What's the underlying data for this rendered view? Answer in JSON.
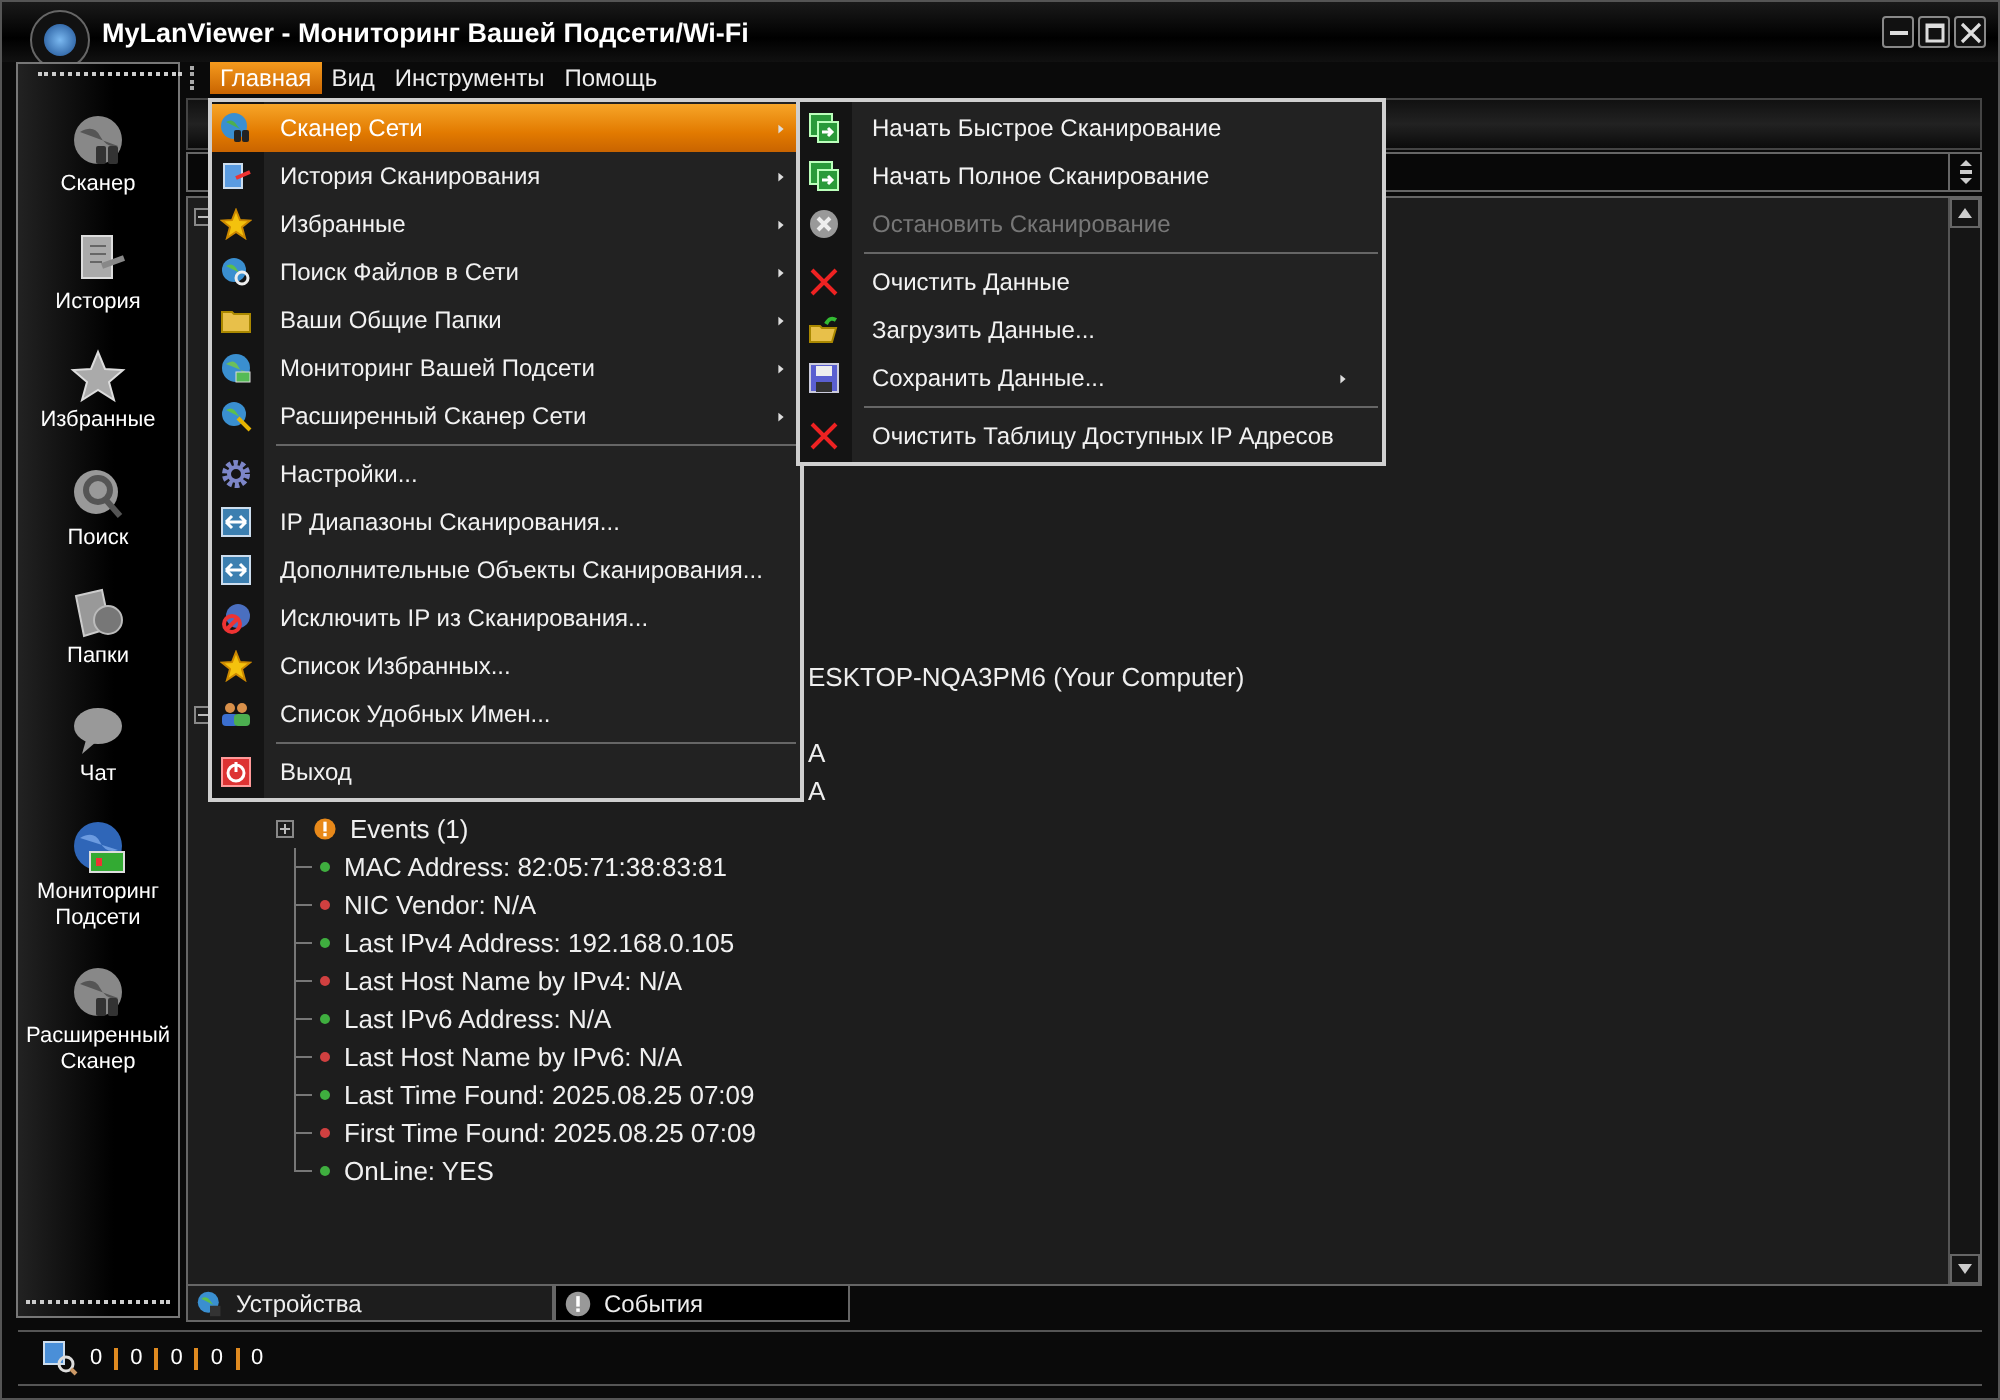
{
  "window": {
    "title": "MyLanViewer - Мониторинг Вашей Подсети/Wi-Fi"
  },
  "sidebar": {
    "items": [
      {
        "label": "Сканер"
      },
      {
        "label": "История"
      },
      {
        "label": "Избранные"
      },
      {
        "label": "Поиск"
      },
      {
        "label": "Папки"
      },
      {
        "label": "Чат"
      },
      {
        "label": "Мониторинг Подсети"
      },
      {
        "label": "Расширенный Сканер"
      }
    ]
  },
  "menu_bar": [
    {
      "label": "Главная",
      "selected": true
    },
    {
      "label": "Вид",
      "selected": false
    },
    {
      "label": "Инструменты",
      "selected": false
    },
    {
      "label": "Помощь",
      "selected": false
    }
  ],
  "main_menu": [
    {
      "kind": "item",
      "label": "Сканер Сети",
      "submenu": true,
      "selected": true
    },
    {
      "kind": "item",
      "label": "История Сканирования",
      "submenu": true,
      "selected": false
    },
    {
      "kind": "item",
      "label": "Избранные",
      "submenu": true,
      "selected": false
    },
    {
      "kind": "item",
      "label": "Поиск Файлов в Сети",
      "submenu": true,
      "selected": false
    },
    {
      "kind": "item",
      "label": "Ваши Общие Папки",
      "submenu": true,
      "selected": false
    },
    {
      "kind": "item",
      "label": "Мониторинг Вашей Подсети",
      "submenu": true,
      "selected": false
    },
    {
      "kind": "item",
      "label": "Расширенный Сканер Сети",
      "submenu": true,
      "selected": false
    },
    {
      "kind": "separator"
    },
    {
      "kind": "item",
      "label": "Настройки...",
      "submenu": false,
      "selected": false
    },
    {
      "kind": "item",
      "label": "IP Диапазоны Сканирования...",
      "submenu": false,
      "selected": false
    },
    {
      "kind": "item",
      "label": "Дополнительные Объекты Сканирования...",
      "submenu": false,
      "selected": false
    },
    {
      "kind": "item",
      "label": "Исключить IP из Сканирования...",
      "submenu": false,
      "selected": false
    },
    {
      "kind": "item",
      "label": "Список Избранных...",
      "submenu": false,
      "selected": false
    },
    {
      "kind": "item",
      "label": "Список Удобных Имен...",
      "submenu": false,
      "selected": false
    },
    {
      "kind": "separator"
    },
    {
      "kind": "item",
      "label": "Выход",
      "submenu": false,
      "selected": false
    }
  ],
  "submenu": [
    {
      "kind": "item",
      "label": "Начать Быстрое Сканирование",
      "disabled": false,
      "submenu": false
    },
    {
      "kind": "item",
      "label": "Начать Полное Сканирование",
      "disabled": false,
      "submenu": false
    },
    {
      "kind": "item",
      "label": "Остановить Сканирование",
      "disabled": true,
      "submenu": false
    },
    {
      "kind": "separator"
    },
    {
      "kind": "item",
      "label": "Очистить Данные",
      "disabled": false,
      "submenu": false
    },
    {
      "kind": "item",
      "label": "Загрузить Данные...",
      "disabled": false,
      "submenu": false
    },
    {
      "kind": "item",
      "label": "Сохранить Данные...",
      "disabled": false,
      "submenu": true
    },
    {
      "kind": "separator"
    },
    {
      "kind": "item",
      "label": "Очистить Таблицу Доступных IP Адресов",
      "disabled": false,
      "submenu": false
    }
  ],
  "tree": {
    "partial_rows": [
      "ESKTOP-NQA3PM6 (Your Computer)",
      "",
      "A",
      "A"
    ],
    "events": {
      "label": "Events (1)",
      "expanded": false
    },
    "properties": [
      {
        "text": "MAC Address: 82:05:71:38:83:81",
        "color": "#3fae3f"
      },
      {
        "text": "NIC Vendor: N/A",
        "color": "#d04040"
      },
      {
        "text": "Last IPv4 Address: 192.168.0.105",
        "color": "#3fae3f"
      },
      {
        "text": "Last Host Name by IPv4: N/A",
        "color": "#d04040"
      },
      {
        "text": "Last IPv6 Address: N/A",
        "color": "#3fae3f"
      },
      {
        "text": "Last Host Name by IPv6: N/A",
        "color": "#d04040"
      },
      {
        "text": "Last Time Found: 2025.08.25  07:09",
        "color": "#3fae3f"
      },
      {
        "text": "First Time Found: 2025.08.25  07:09",
        "color": "#d04040"
      },
      {
        "text": "OnLine: YES",
        "color": "#3fae3f"
      }
    ]
  },
  "bottom_tabs": [
    {
      "label": "Устройства",
      "selected": true
    },
    {
      "label": "События",
      "selected": false
    }
  ],
  "status_bar": {
    "counts": [
      "0",
      "0",
      "0",
      "0",
      "0"
    ]
  }
}
